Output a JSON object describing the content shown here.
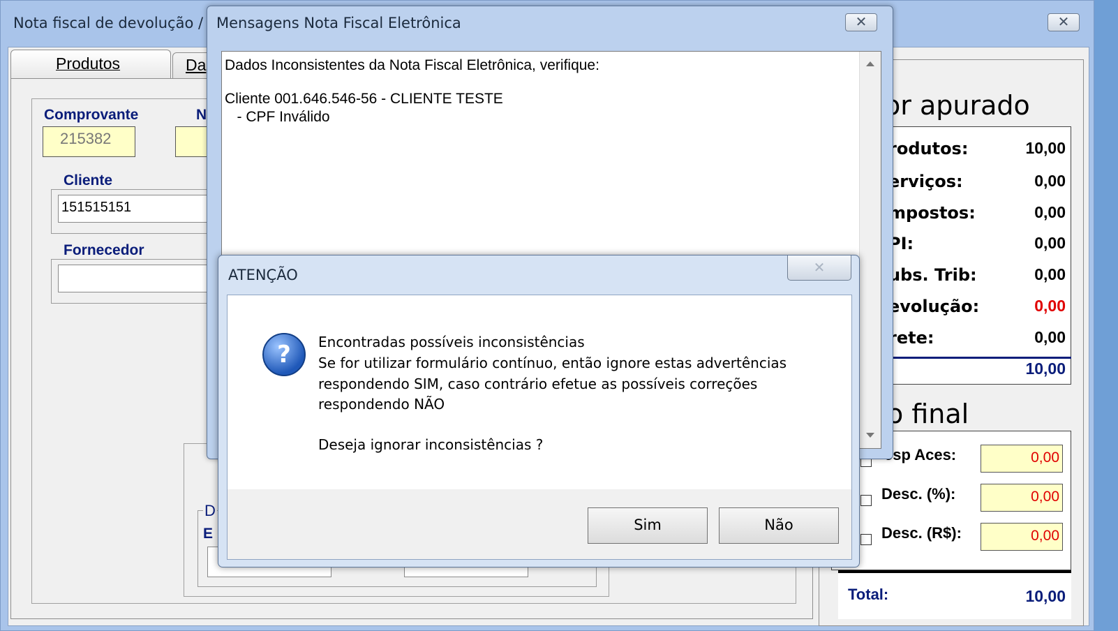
{
  "main_window": {
    "title": "Nota fiscal de devolução / ",
    "tab_produtos": "Produtos",
    "tab_dados": "Da",
    "comprovante_label": "Comprovante",
    "comprovante_value": "215382",
    "n_label": "N",
    "cliente_label": "Cliente",
    "cliente_value": "151515151",
    "fornecedor_label": "Fornecedor",
    "fornecedor_value": "",
    "lower_label_1": "D",
    "lower_label_2": "E"
  },
  "summary": {
    "header_apurado": "or apurado",
    "rows": [
      {
        "label": "rodutos:",
        "value": "10,00"
      },
      {
        "label": "erviços:",
        "value": "0,00"
      },
      {
        "label": "mpostos:",
        "value": "0,00"
      },
      {
        "label": "PI:",
        "value": "0,00"
      },
      {
        "label": "ubs. Trib:",
        "value": "0,00"
      },
      {
        "label": "evolução:",
        "value": "0,00"
      },
      {
        "label": "rete:",
        "value": "0,00"
      }
    ],
    "subtotal_label": ":",
    "subtotal_value": "10,00",
    "header_final": "o final",
    "final_rows": [
      {
        "label": "esp Aces:",
        "value": "0,00"
      },
      {
        "label": "Desc. (%):",
        "value": "0,00"
      },
      {
        "label": "Desc. (R$):",
        "value": "0,00"
      }
    ],
    "total_label": "Total:",
    "total_value": "10,00",
    "devolucao_color": "#e00000"
  },
  "messages_dialog": {
    "title": "Mensagens Nota Fiscal Eletrônica",
    "line1": "Dados Inconsistentes da Nota Fiscal Eletrônica, verifique:",
    "line2": "Cliente 001.646.546-56 - CLIENTE TESTE",
    "line3": "   - CPF Inválido"
  },
  "atencao_dialog": {
    "title": "ATENÇÃO",
    "icon": "question-icon",
    "msg1": "Encontradas possíveis inconsistências",
    "msg2": "Se for utilizar formulário contínuo, então ignore estas advertências",
    "msg3": "respondendo SIM, caso contrário efetue as possíveis correções",
    "msg4": "respondendo NÃO",
    "question": "Deseja ignorar inconsistências ?",
    "btn_sim": "Sim",
    "btn_nao": "Não"
  },
  "close_glyph": "☒"
}
